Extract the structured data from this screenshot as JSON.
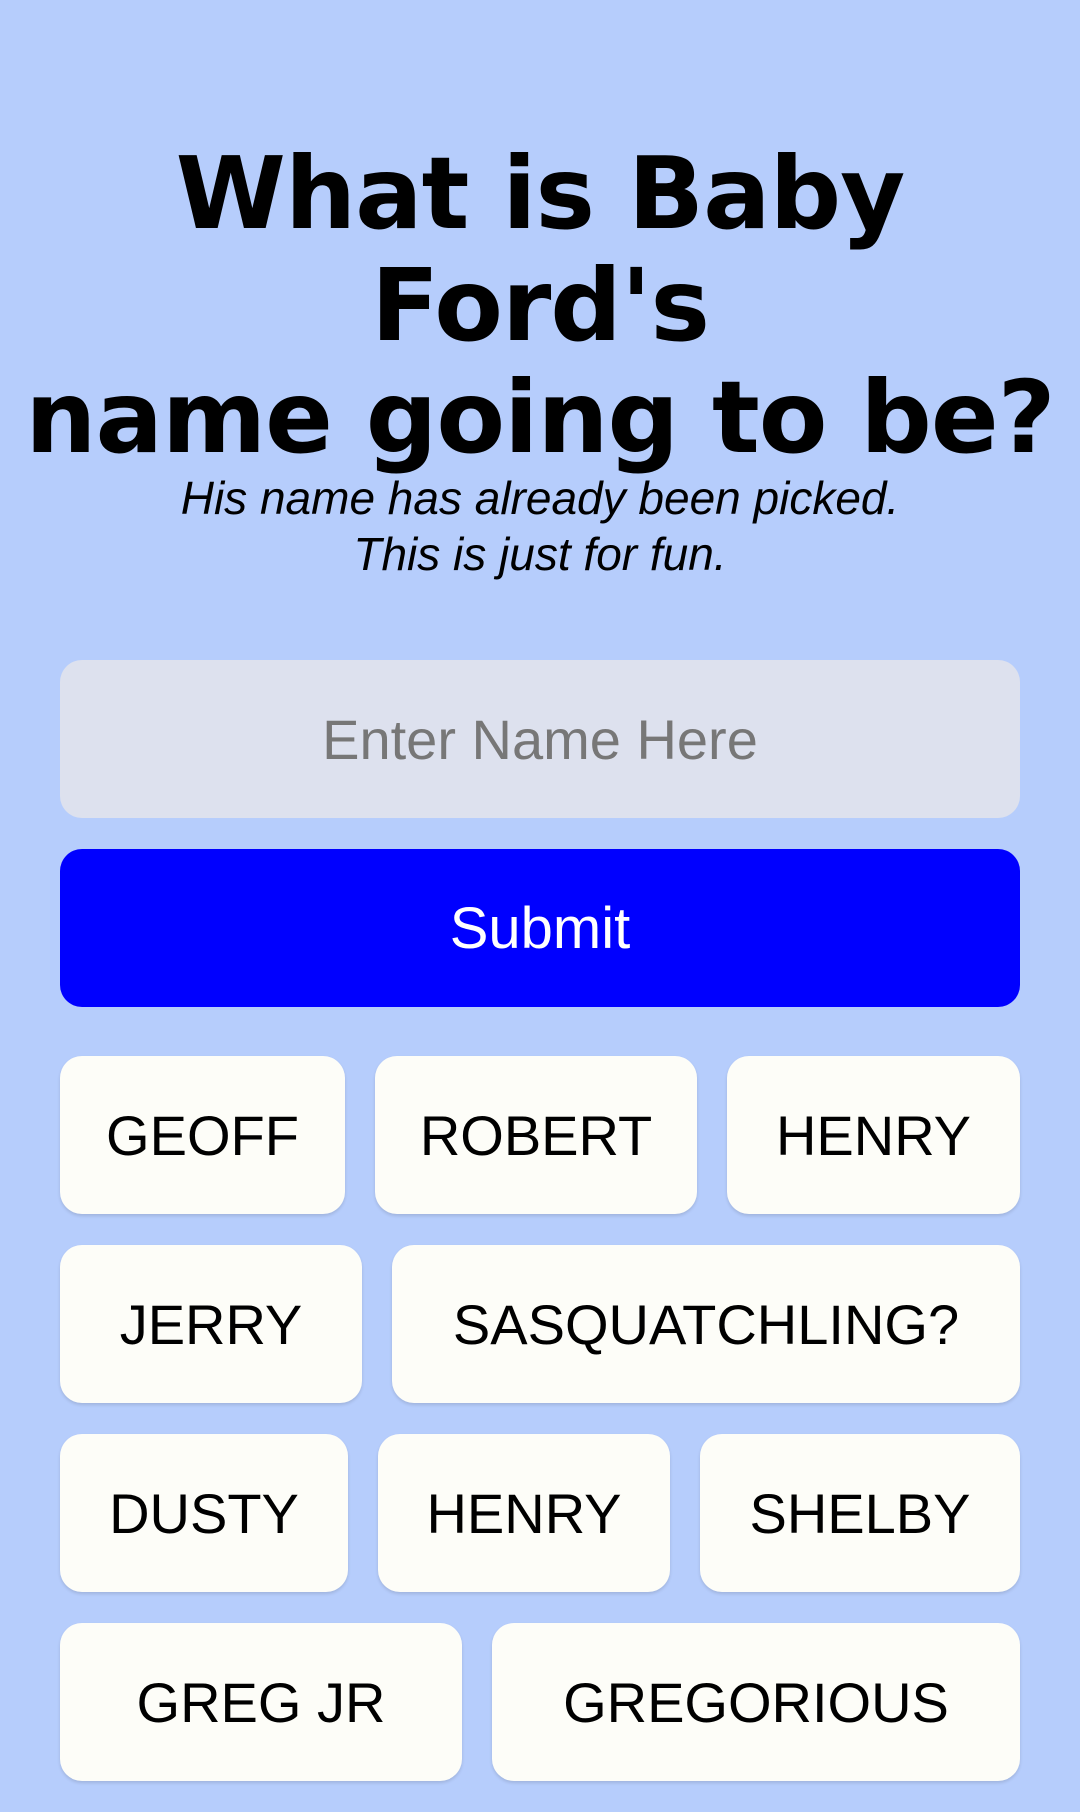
{
  "header": {
    "title_line1": "What is Baby Ford's",
    "title_line2": "name going to be?",
    "subtitle_line1": "His name has already been picked.",
    "subtitle_line2": "This is just for fun."
  },
  "form": {
    "input_placeholder": "Enter Name Here",
    "input_value": "",
    "submit_label": "Submit",
    "submit_color": "#0000ff"
  },
  "names": [
    [
      "GEOFF",
      "ROBERT",
      "HENRY"
    ],
    [
      "JERRY",
      "SASQUATCHLING?"
    ],
    [
      "DUSTY",
      "HENRY",
      "SHELBY"
    ],
    [
      "GREG JR",
      "GREGORIOUS"
    ]
  ],
  "colors": {
    "background": "#b6cdfc",
    "input_background": "#dde1ee",
    "chip_background": "#fdfdf8"
  }
}
